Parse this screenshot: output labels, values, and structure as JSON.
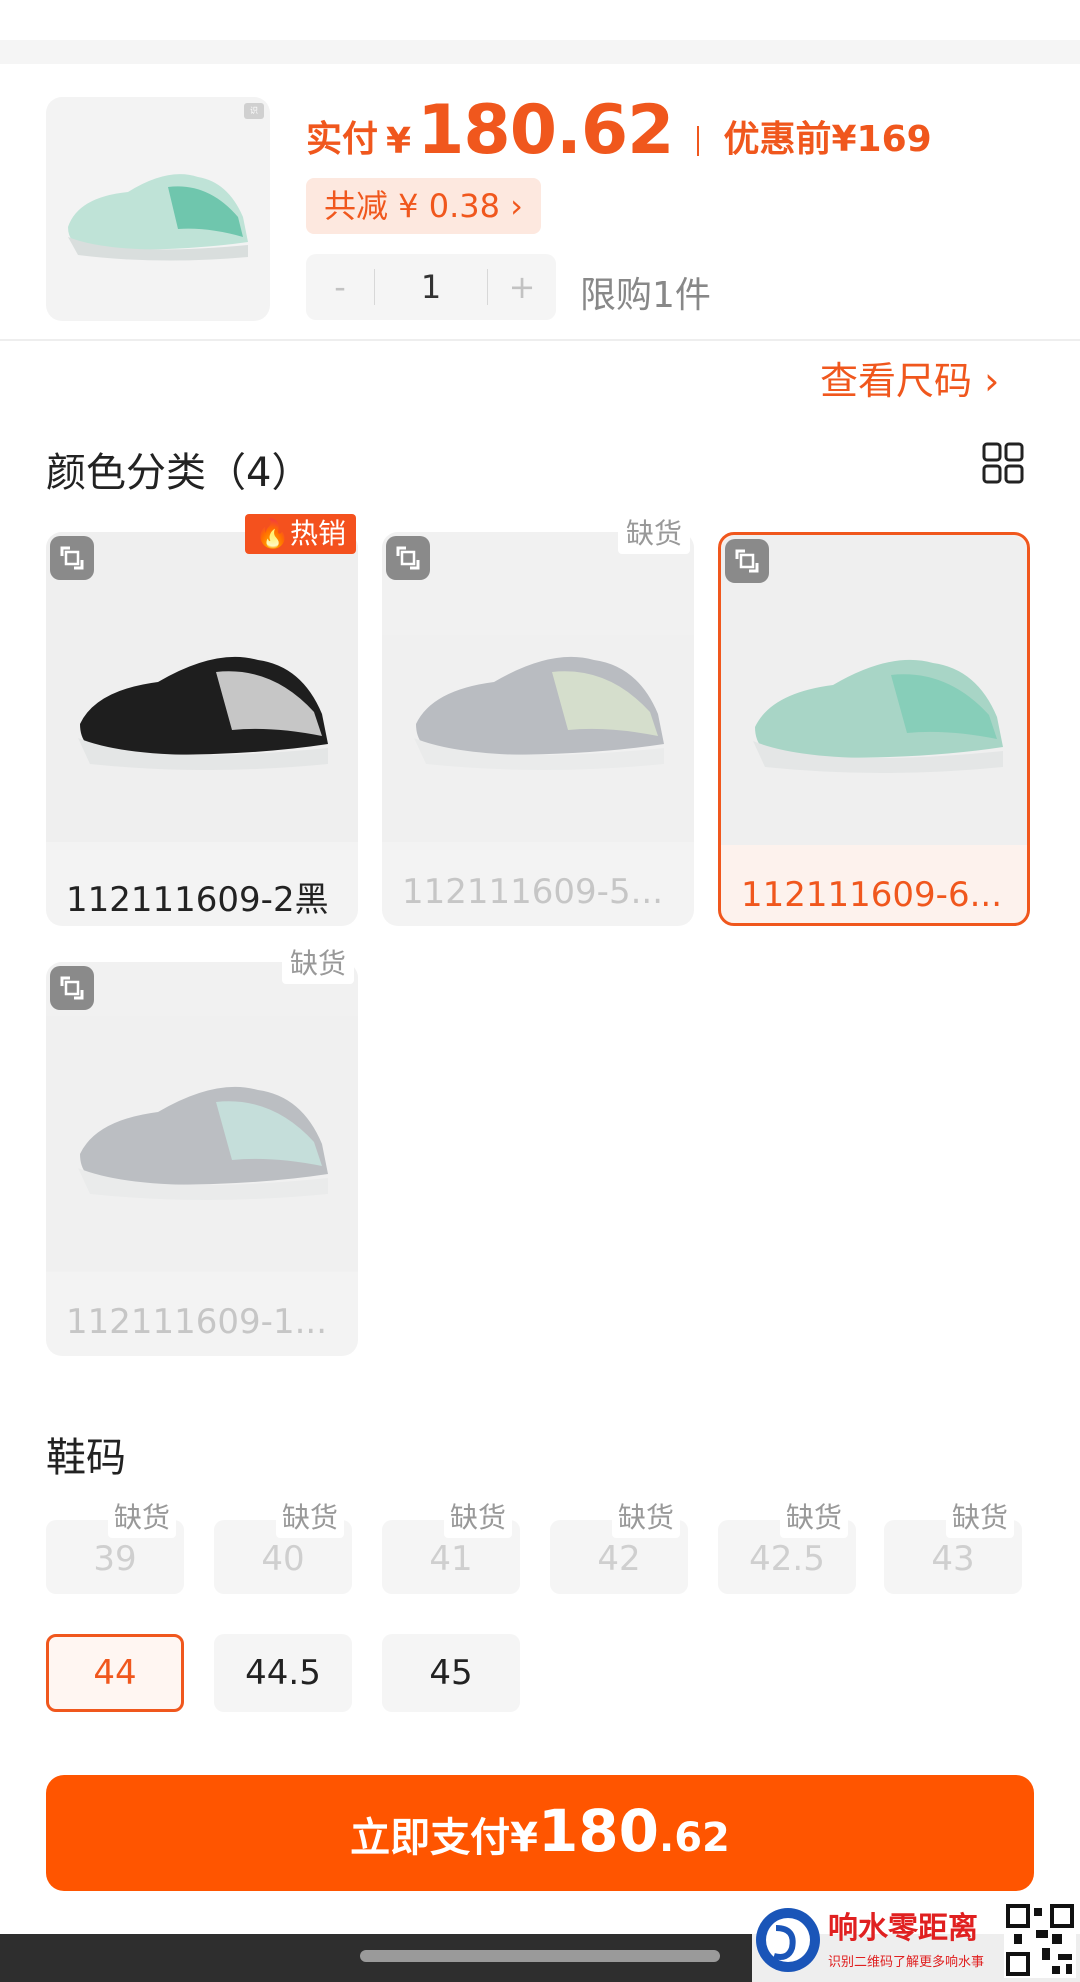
{
  "header": {
    "price_prefix": "实付",
    "price_currency": "¥",
    "price_value": "180.62",
    "original_price": "优惠前¥169",
    "discount_text": "共减 ¥ 0.38 ›",
    "qty_minus": "-",
    "qty_value": "1",
    "qty_plus": "+",
    "limit_text": "限购1件"
  },
  "size_chart_link": "查看尺码 ›",
  "colors": {
    "title": "颜色分类（4）",
    "items": [
      {
        "label": "112111609-2黑",
        "tag": "热销",
        "status": "available",
        "shoe_color": "#1e1e1e",
        "accent": "#ffffff"
      },
      {
        "label": "112111609-5...",
        "tag": "缺货",
        "status": "out_of_stock",
        "shoe_color": "#8a9099",
        "accent": "#cfe3b4"
      },
      {
        "label": "112111609-6...",
        "tag": "",
        "status": "selected",
        "shoe_color": "#a8d5c6",
        "accent": "#7ccbb4"
      },
      {
        "label": "112111609-1...",
        "tag": "缺货",
        "status": "out_of_stock",
        "shoe_color": "#8e949b",
        "accent": "#a5e0d4"
      }
    ]
  },
  "sizes": {
    "title": "鞋码",
    "oos_tag": "缺货",
    "items": [
      {
        "label": "39",
        "status": "out_of_stock"
      },
      {
        "label": "40",
        "status": "out_of_stock"
      },
      {
        "label": "41",
        "status": "out_of_stock"
      },
      {
        "label": "42",
        "status": "out_of_stock"
      },
      {
        "label": "42.5",
        "status": "out_of_stock"
      },
      {
        "label": "43",
        "status": "out_of_stock"
      },
      {
        "label": "44",
        "status": "selected"
      },
      {
        "label": "44.5",
        "status": "available"
      },
      {
        "label": "45",
        "status": "available"
      }
    ]
  },
  "pay_button": {
    "text": "立即支付¥",
    "int": "180",
    "dec": ".62"
  },
  "watermark": {
    "title": "响水零距离",
    "subtitle": "识别二维码了解更多响水事"
  },
  "colors_theme": {
    "accent": "#f0571d",
    "pay": "#ff5500"
  }
}
